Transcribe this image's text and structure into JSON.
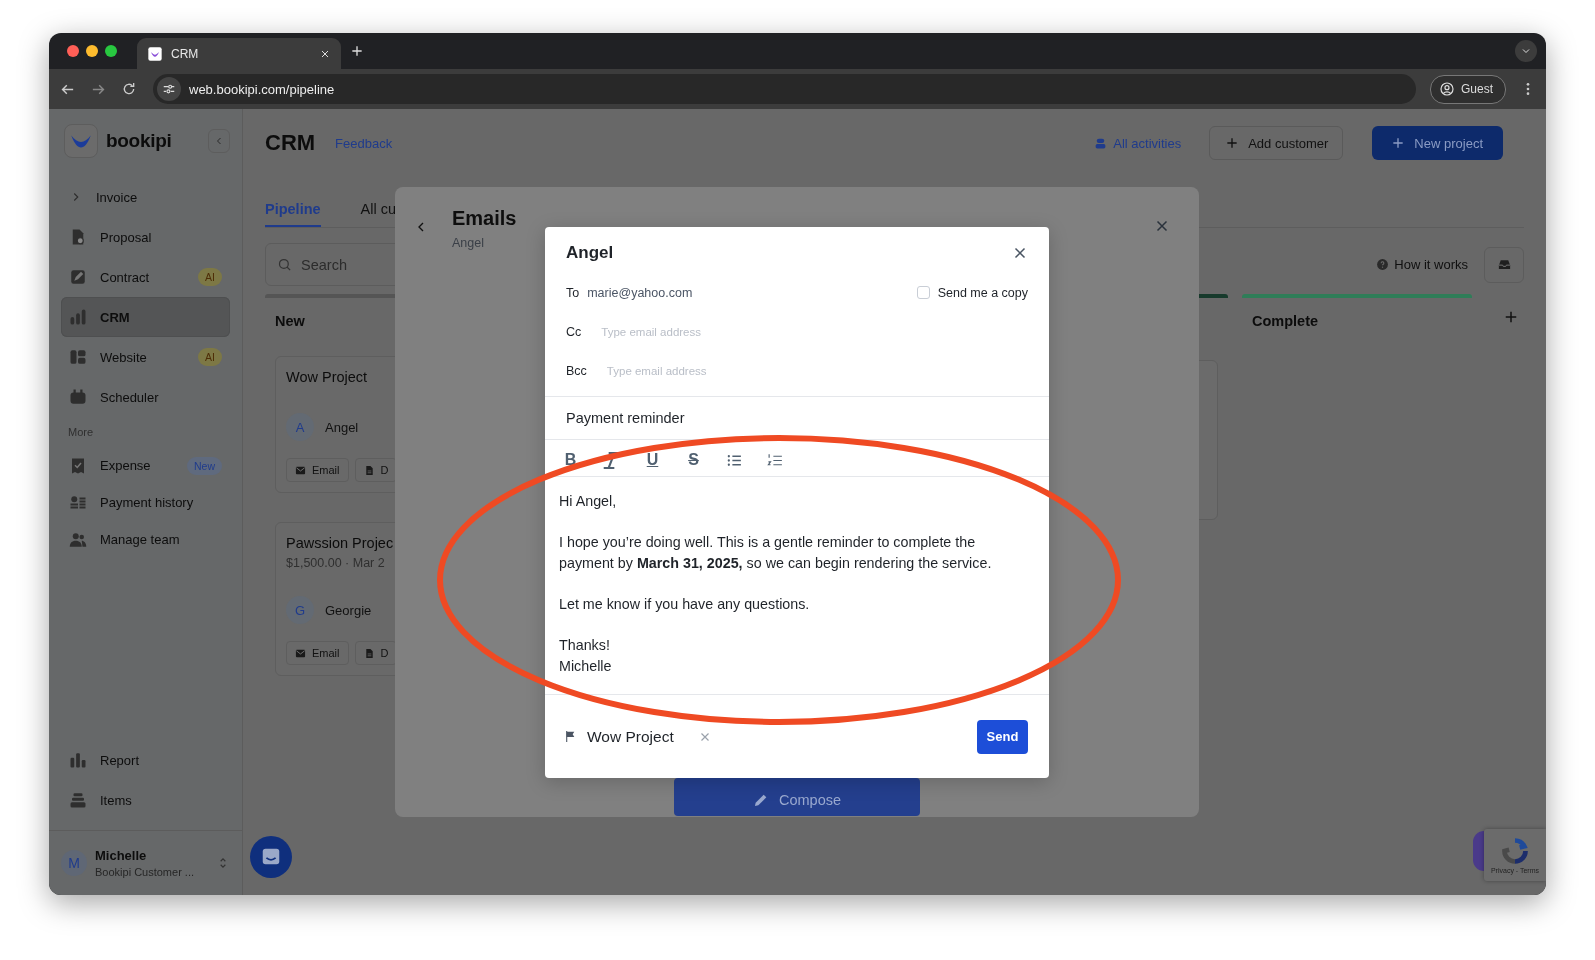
{
  "browser": {
    "tab_title": "CRM",
    "url": "web.bookipi.com/pipeline",
    "profile": "Guest"
  },
  "sidebar": {
    "brand": "bookipi",
    "items": [
      {
        "label": "Invoice",
        "selected": false
      },
      {
        "label": "Proposal",
        "selected": false
      },
      {
        "label": "Contract",
        "badge": {
          "text": "AI",
          "kind": "ai"
        },
        "selected": false
      },
      {
        "label": "CRM",
        "selected": true
      },
      {
        "label": "Website",
        "badge": {
          "text": "AI",
          "kind": "ai"
        },
        "selected": false
      },
      {
        "label": "Scheduler",
        "selected": false
      }
    ],
    "more_label": "More",
    "more_items": [
      {
        "label": "Expense",
        "badge": {
          "text": "New",
          "kind": "new"
        },
        "selected": false
      },
      {
        "label": "Payment history",
        "selected": false
      },
      {
        "label": "Manage team",
        "selected": false
      }
    ],
    "bottom_items": [
      {
        "label": "Report",
        "selected": false
      },
      {
        "label": "Items",
        "selected": false
      }
    ],
    "user": {
      "initial": "M",
      "name": "Michelle",
      "subtitle": "Bookipi Customer ..."
    }
  },
  "header": {
    "title": "CRM",
    "feedback": "Feedback",
    "all_activities": "All activities",
    "add_customer": "Add customer",
    "new_project": "New project"
  },
  "tabs": [
    {
      "label": "Pipeline",
      "selected": true
    },
    {
      "label": "All cu",
      "selected": false
    }
  ],
  "search": {
    "placeholder": "Search"
  },
  "how_it_works": "How it works",
  "columns": [
    {
      "title": "New",
      "color": "#555555",
      "cards": [
        {
          "title": "Wow Project",
          "contact_initial": "A",
          "contact": "Angel",
          "actions": [
            "Email",
            "D"
          ]
        },
        {
          "title": "Pawssion Projec",
          "meta": "$1,500.00 · Mar 2",
          "contact_initial": "G",
          "contact": "Georgie",
          "actions": [
            "Email",
            "D"
          ]
        }
      ]
    },
    {
      "color": "#173a2c"
    },
    {
      "title": "Complete",
      "color": "#2f7d58"
    }
  ],
  "emails_panel": {
    "title": "Emails",
    "subtitle": "Angel",
    "compose": "Compose"
  },
  "compose": {
    "title": "Angel",
    "to_label": "To",
    "to": "marie@yahoo.com",
    "send_copy": {
      "label": "Send me a copy",
      "checked": false
    },
    "cc": {
      "label": "Cc",
      "placeholder": "Type email address"
    },
    "bcc": {
      "label": "Bcc",
      "placeholder": "Type email address"
    },
    "subject": "Payment reminder",
    "toolbar": [
      {
        "kind": "bold",
        "glyph": "B"
      },
      {
        "kind": "italic"
      },
      {
        "kind": "underline",
        "glyph": "U"
      },
      {
        "kind": "strike",
        "glyph": "S"
      },
      {
        "kind": "bullets"
      },
      {
        "kind": "numbers"
      }
    ],
    "body": [
      [
        "Hi Angel,"
      ],
      [
        "I hope you’re doing well. This is a gentle reminder to complete the payment by **March 31, 2025,** so we can begin rendering the service."
      ],
      [
        "Let me know if you have any questions."
      ],
      [
        "Thanks!",
        "Michelle"
      ]
    ],
    "project": "Wow Project",
    "send": "Send"
  },
  "recaptcha": "Privacy - Terms"
}
